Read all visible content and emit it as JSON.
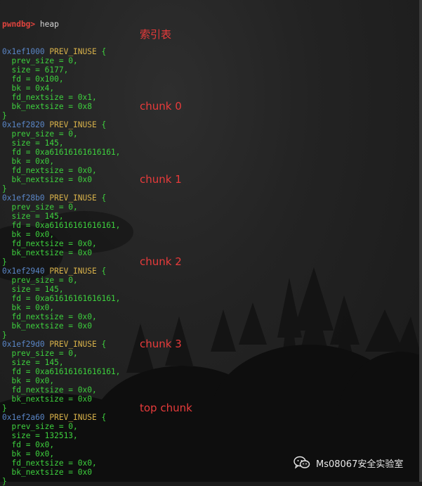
{
  "prompt": "pwndbg>",
  "command": "heap",
  "chunks": [
    {
      "address": "0x1ef1000",
      "flag": "PREV_INUSE",
      "fields": [
        "prev_size = 0,",
        "size = 6177,",
        "fd = 0x100,",
        "bk = 0x4,",
        "fd_nextsize = 0x1,",
        "bk_nextsize = 0x8"
      ],
      "annotation": "索引表"
    },
    {
      "address": "0x1ef2820",
      "flag": "PREV_INUSE",
      "fields": [
        "prev_size = 0,",
        "size = 145,",
        "fd = 0xa61616161616161,",
        "bk = 0x0,",
        "fd_nextsize = 0x0,",
        "bk_nextsize = 0x0"
      ],
      "annotation": "chunk 0"
    },
    {
      "address": "0x1ef28b0",
      "flag": "PREV_INUSE",
      "fields": [
        "prev_size = 0,",
        "size = 145,",
        "fd = 0xa61616161616161,",
        "bk = 0x0,",
        "fd_nextsize = 0x0,",
        "bk_nextsize = 0x0"
      ],
      "annotation": "chunk 1"
    },
    {
      "address": "0x1ef2940",
      "flag": "PREV_INUSE",
      "fields": [
        "prev_size = 0,",
        "size = 145,",
        "fd = 0xa61616161616161,",
        "bk = 0x0,",
        "fd_nextsize = 0x0,",
        "bk_nextsize = 0x0"
      ],
      "annotation": "chunk 2"
    },
    {
      "address": "0x1ef29d0",
      "flag": "PREV_INUSE",
      "fields": [
        "prev_size = 0,",
        "size = 145,",
        "fd = 0xa61616161616161,",
        "bk = 0x0,",
        "fd_nextsize = 0x0,",
        "bk_nextsize = 0x0"
      ],
      "annotation": "chunk 3"
    },
    {
      "address": "0x1ef2a60",
      "flag": "PREV_INUSE",
      "fields": [
        "prev_size = 0,",
        "size = 132513,",
        "fd = 0x0,",
        "bk = 0x0,",
        "fd_nextsize = 0x0,",
        "bk_nextsize = 0x0"
      ],
      "annotation": "top chunk"
    }
  ],
  "watermark": {
    "icon": "wechat-icon",
    "text": "Ms08067安全实验室"
  },
  "colors": {
    "prompt": "#e0443e",
    "address": "#5a86c7",
    "flag": "#d9b24a",
    "field": "#3ed23e",
    "annotation": "#e83b3b"
  }
}
